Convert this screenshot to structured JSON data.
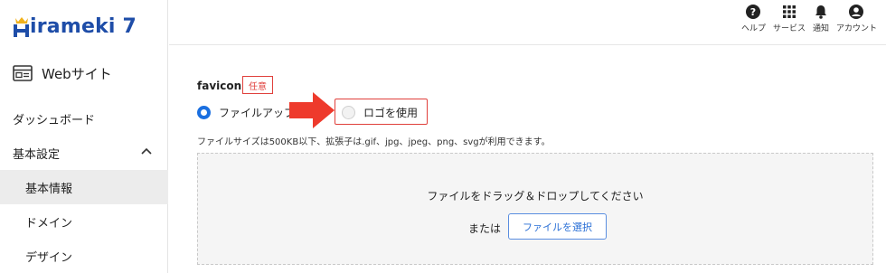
{
  "brand": {
    "logo_text": "irameki 7",
    "logo_letter": "H"
  },
  "sidebar": {
    "site_label": "Webサイト",
    "items": [
      {
        "label": "ダッシュボード"
      },
      {
        "label": "基本設定"
      },
      {
        "label": "基本情報"
      },
      {
        "label": "ドメイン"
      },
      {
        "label": "デザイン"
      }
    ]
  },
  "topbar": {
    "help": "ヘルプ",
    "services": "サービス",
    "notifications": "通知",
    "account": "アカウント"
  },
  "favicon": {
    "label": "favicon",
    "badge": "任意",
    "option_upload": "ファイルアップ",
    "option_logo": "ロゴを使用",
    "help_text": "ファイルサイズは500KB以下、拡張子は.gif、jpg、jpeg、png、svgが利用できます。",
    "dropzone_title": "ファイルをドラッグ＆ドロップしてください",
    "dropzone_or": "または",
    "select_button": "ファイルを選択"
  },
  "colors": {
    "accent": "#1a6fe0",
    "brand": "#1e4da8",
    "warning": "#e0403c",
    "arrow": "#ee3a2c"
  }
}
